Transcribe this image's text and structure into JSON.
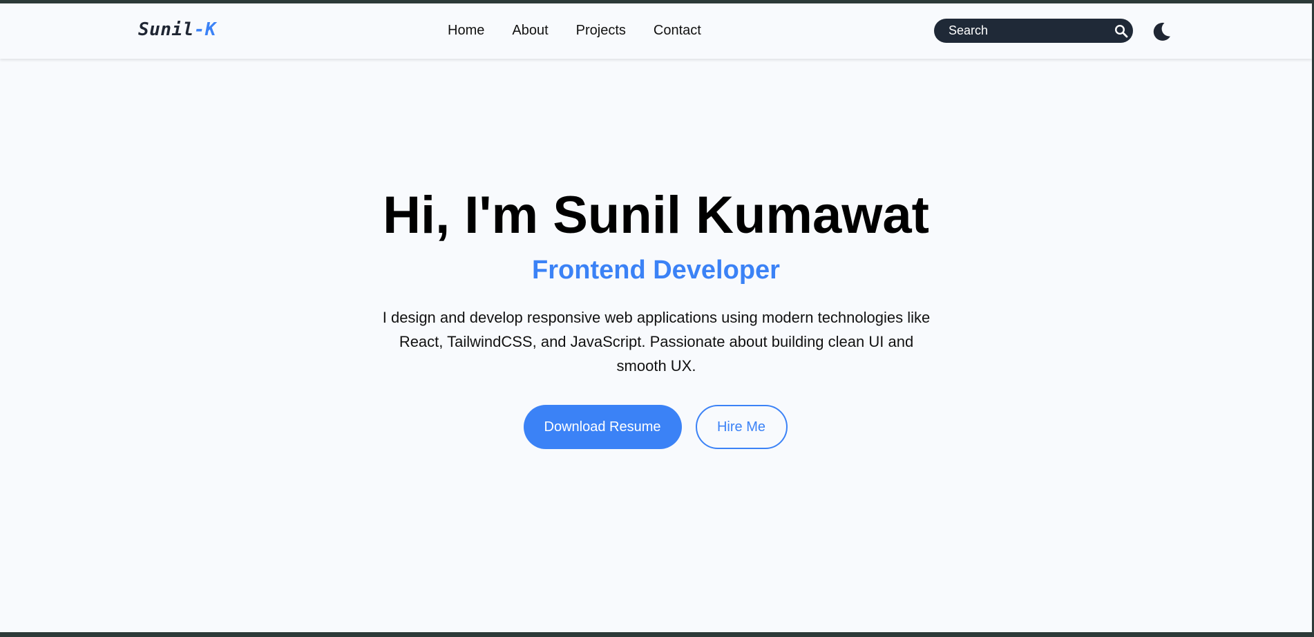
{
  "navbar": {
    "logo_main": "Sunil",
    "logo_accent": "-K",
    "links": [
      {
        "label": "Home"
      },
      {
        "label": "About"
      },
      {
        "label": "Projects"
      },
      {
        "label": "Contact"
      }
    ],
    "search": {
      "placeholder": "Search",
      "icon": "search-icon"
    },
    "theme_toggle_icon": "moon-icon"
  },
  "hero": {
    "title": "Hi, I'm Sunil Kumawat",
    "subtitle": "Frontend Developer",
    "description": "I design and develop responsive web applications using modern technologies like React, TailwindCSS, and JavaScript. Passionate about building clean UI and smooth UX.",
    "primary_button": "Download Resume",
    "secondary_button": "Hire Me"
  },
  "colors": {
    "accent": "#3b82f6",
    "page_background": "#f8fafd",
    "search_background": "#1f2937",
    "text": "#000000"
  }
}
